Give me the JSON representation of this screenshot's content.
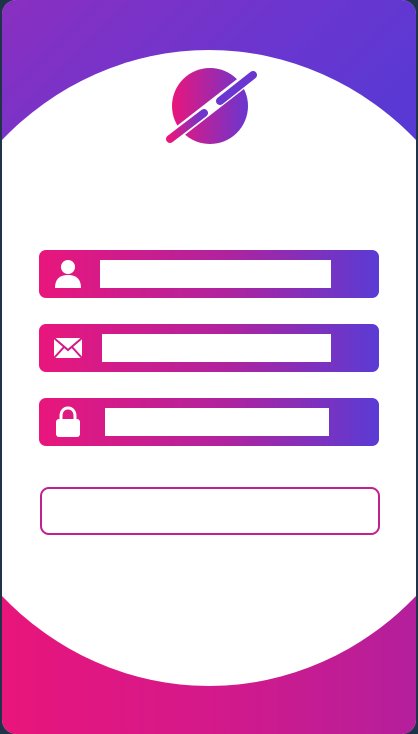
{
  "form": {
    "username": {
      "icon": "user-icon",
      "value": "",
      "placeholder": ""
    },
    "email": {
      "icon": "envelope-icon",
      "value": "",
      "placeholder": ""
    },
    "password": {
      "icon": "lock-icon",
      "value": "",
      "placeholder": ""
    },
    "submit_label": ""
  },
  "logo": {
    "icon": "planet-logo-icon"
  },
  "colors": {
    "pink": "#e8157b",
    "magenta": "#b0239e",
    "violet": "#5a3bd4",
    "frame_border": "#1f3448"
  }
}
